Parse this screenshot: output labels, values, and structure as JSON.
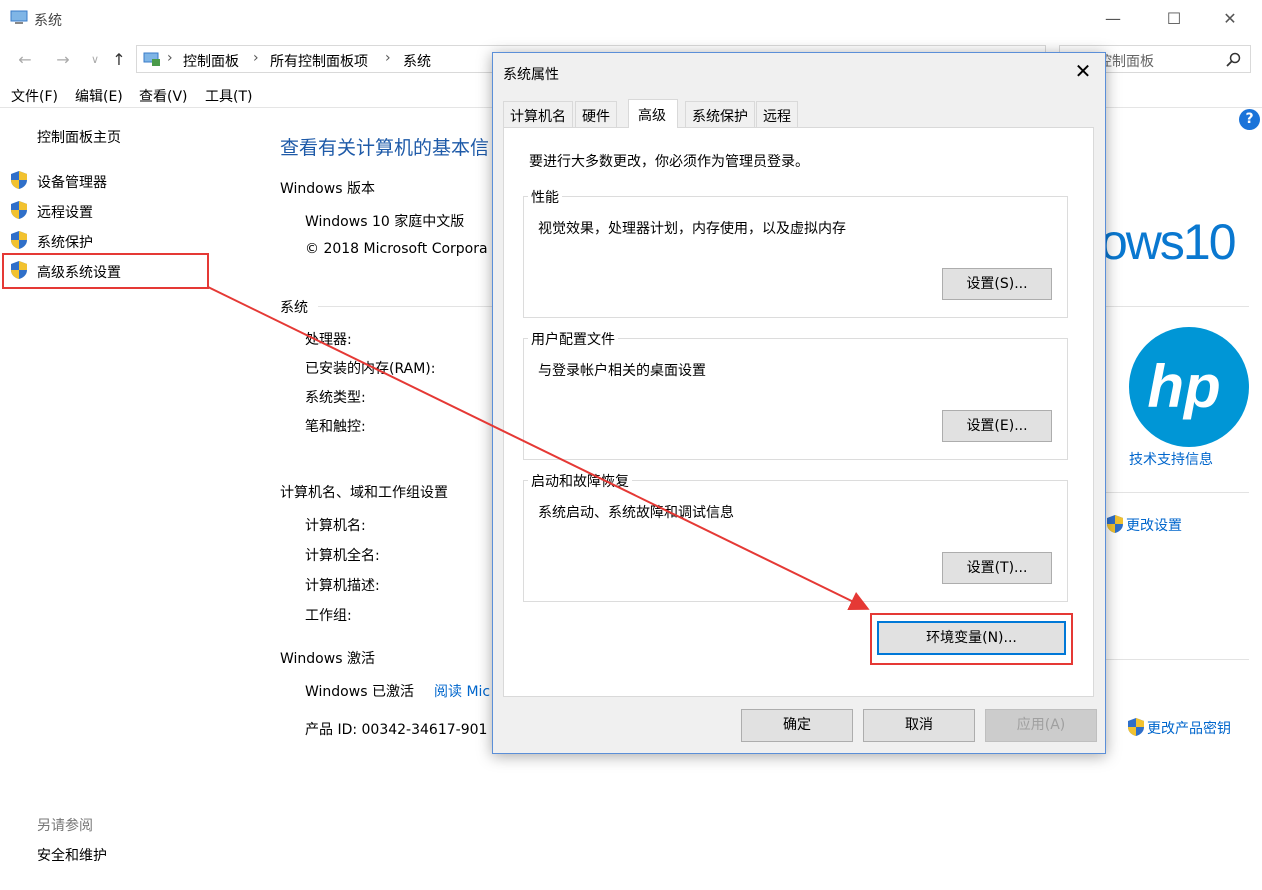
{
  "window": {
    "title": "系统",
    "controls": {
      "minimize": "—",
      "maximize": "☐",
      "close": "✕"
    }
  },
  "address": {
    "breadcrumb": [
      "控制面板",
      "所有控制面板项",
      "系统"
    ],
    "separator": "›",
    "search_placeholder": "控制面板"
  },
  "menu": [
    "文件(F)",
    "编辑(E)",
    "查看(V)",
    "工具(T)"
  ],
  "sidebar": {
    "home": "控制面板主页",
    "items": [
      "设备管理器",
      "远程设置",
      "系统保护",
      "高级系统设置"
    ],
    "see_also_header": "另请参阅",
    "see_also": [
      "安全和维护"
    ]
  },
  "main": {
    "page_title": "查看有关计算机的基本信",
    "windows_edition": {
      "header": "Windows 版本",
      "edition": "Windows 10 家庭中文版",
      "copyright": "© 2018 Microsoft Corpora"
    },
    "system": {
      "header": "系统",
      "labels": [
        "处理器:",
        "已安装的内存(RAM):",
        "系统类型:",
        "笔和触控:"
      ]
    },
    "computer": {
      "header": "计算机名、域和工作组设置",
      "labels": [
        "计算机名:",
        "计算机全名:",
        "计算机描述:",
        "工作组:"
      ],
      "change_settings": "更改设置"
    },
    "activation": {
      "header": "Windows 激活",
      "status": "Windows 已激活",
      "read_link": "阅读 Mic",
      "product_id": "产品 ID: 00342-34617-901",
      "change_key": "更改产品密钥"
    },
    "brand": {
      "win10_text": "ows10",
      "hp_logo_text": "hp",
      "support_link": "技术支持信息"
    },
    "help_icon": "?"
  },
  "dialog": {
    "title": "系统属性",
    "close": "✕",
    "tabs": [
      "计算机名",
      "硬件",
      "高级",
      "系统保护",
      "远程"
    ],
    "active_tab": "高级",
    "admin_note": "要进行大多数更改，你必须作为管理员登录。",
    "groups": [
      {
        "title": "性能",
        "desc": "视觉效果，处理器计划，内存使用，以及虚拟内存",
        "button": "设置(S)..."
      },
      {
        "title": "用户配置文件",
        "desc": "与登录帐户相关的桌面设置",
        "button": "设置(E)..."
      },
      {
        "title": "启动和故障恢复",
        "desc": "系统启动、系统故障和调试信息",
        "button": "设置(T)..."
      }
    ],
    "env_button": "环境变量(N)...",
    "ok": "确定",
    "cancel": "取消",
    "apply": "应用(A)"
  },
  "colors": {
    "link": "#0066cc",
    "title_blue": "#1e5aa8",
    "highlight_red": "#e53935",
    "hp_blue": "#0096d6",
    "dialog_border": "#5b8fd8"
  }
}
